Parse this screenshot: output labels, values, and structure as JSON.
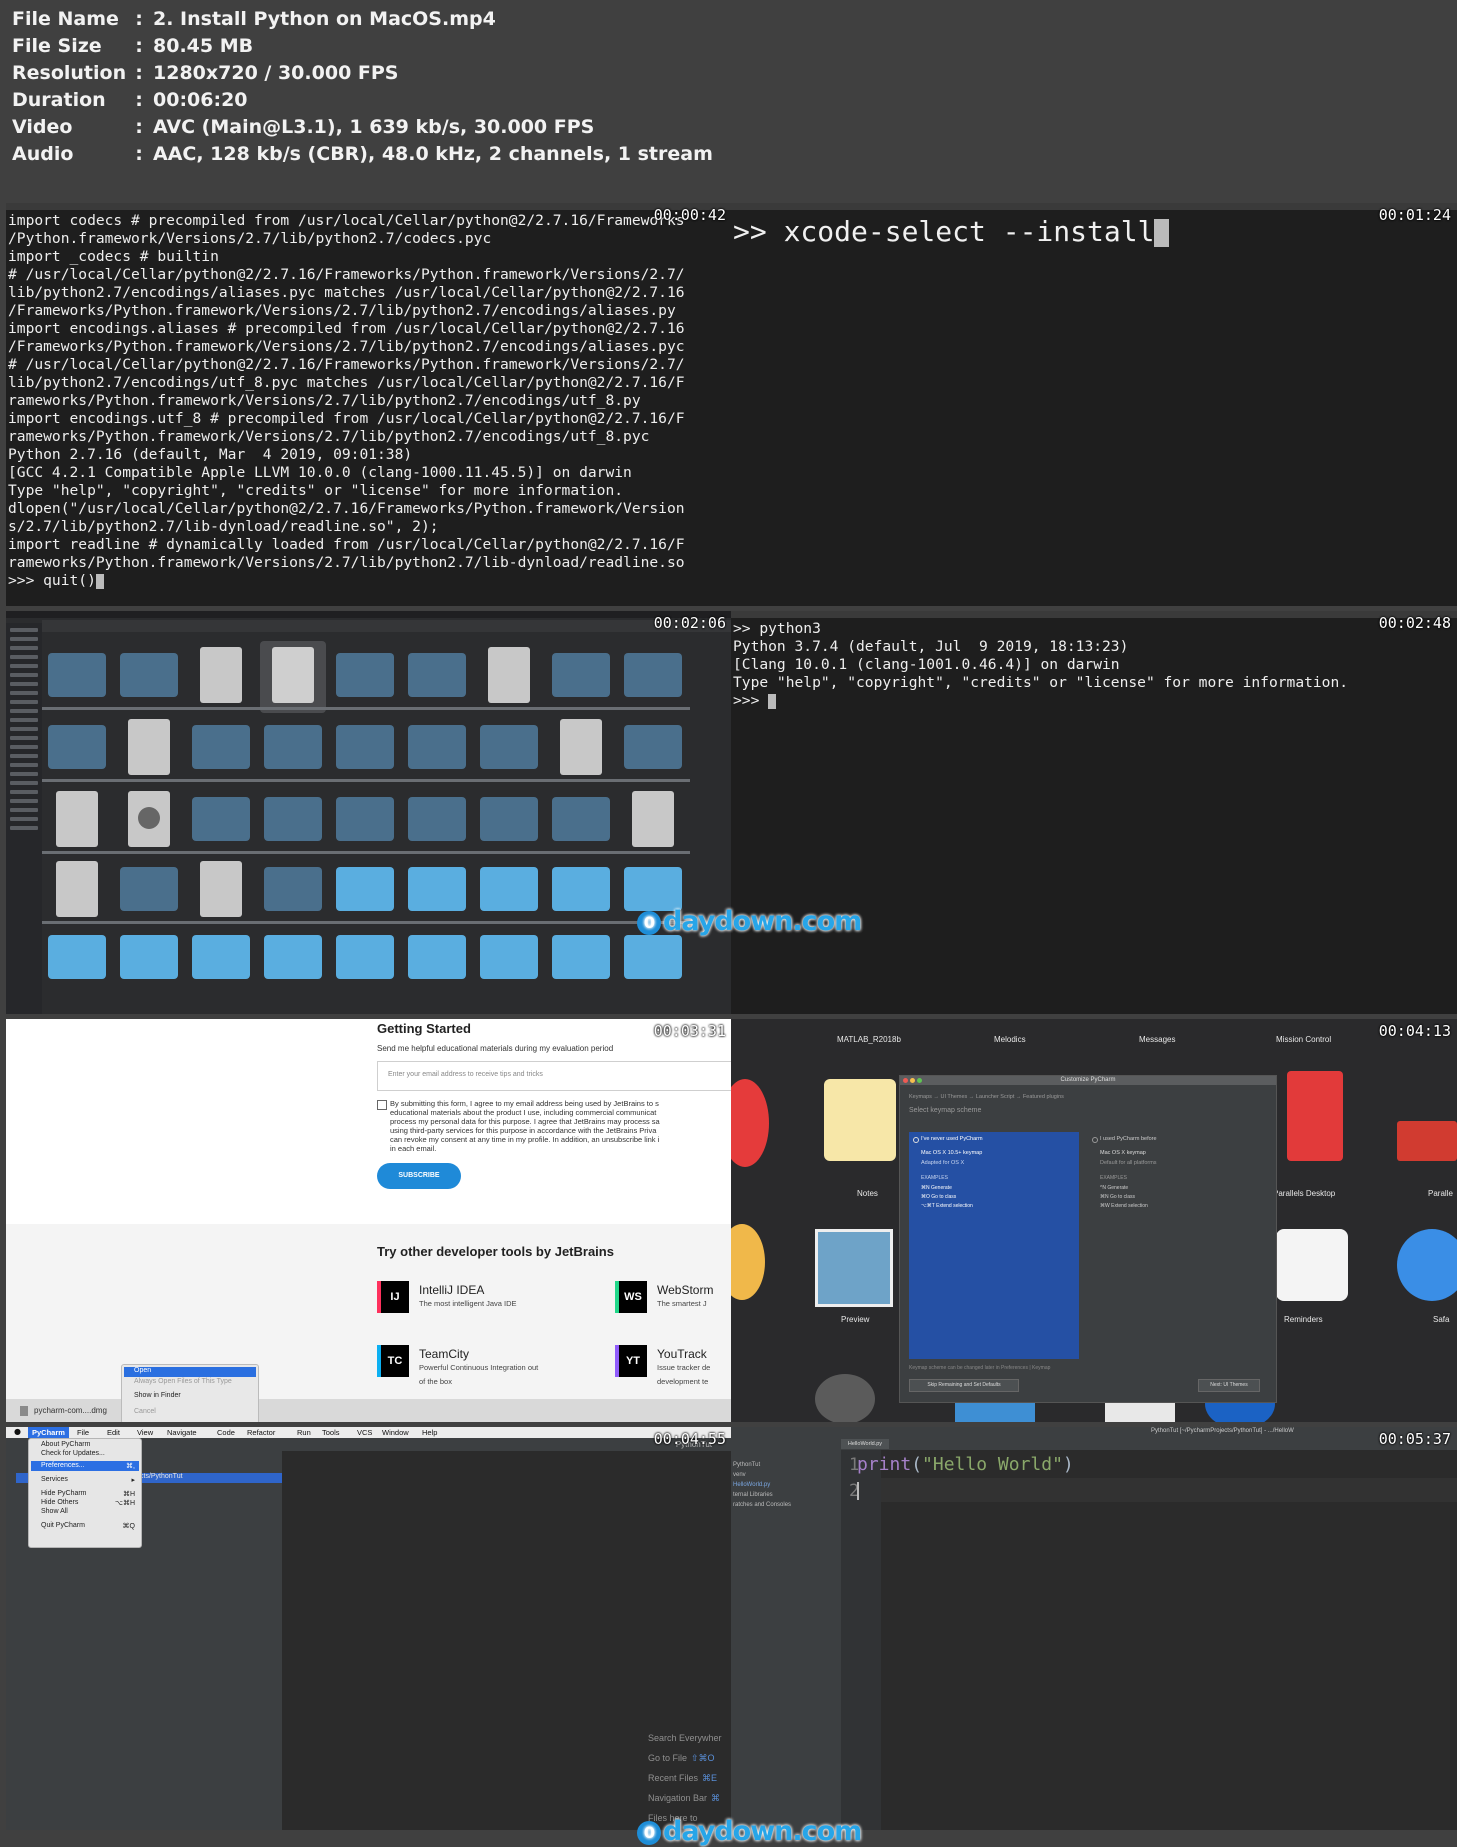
{
  "info": [
    {
      "key": "File Name",
      "sep": ":",
      "value": "2. Install Python on MacOS.mp4"
    },
    {
      "key": "File Size",
      "sep": ":",
      "value": "80.45 MB"
    },
    {
      "key": "Resolution",
      "sep": ":",
      "value": "1280x720 / 30.000 FPS"
    },
    {
      "key": "Duration",
      "sep": ":",
      "value": "00:06:20"
    },
    {
      "key": "Video",
      "sep": ":",
      "value": "AVC (Main@L3.1), 1 639 kb/s, 30.000 FPS"
    },
    {
      "key": "Audio",
      "sep": ":",
      "value": "AAC, 128 kb/s (CBR), 48.0 kHz, 2 channels, 1 stream"
    }
  ],
  "thumbs": [
    {
      "timestamp": "00:00:42",
      "lines": [
        "import codecs # precompiled from /usr/local/Cellar/python@2/2.7.16/Frameworks",
        "/Python.framework/Versions/2.7/lib/python2.7/codecs.pyc",
        "import _codecs # builtin",
        "# /usr/local/Cellar/python@2/2.7.16/Frameworks/Python.framework/Versions/2.7/",
        "lib/python2.7/encodings/aliases.pyc matches /usr/local/Cellar/python@2/2.7.16",
        "/Frameworks/Python.framework/Versions/2.7/lib/python2.7/encodings/aliases.py",
        "import encodings.aliases # precompiled from /usr/local/Cellar/python@2/2.7.16",
        "/Frameworks/Python.framework/Versions/2.7/lib/python2.7/encodings/aliases.pyc",
        "# /usr/local/Cellar/python@2/2.7.16/Frameworks/Python.framework/Versions/2.7/",
        "lib/python2.7/encodings/utf_8.pyc matches /usr/local/Cellar/python@2/2.7.16/F",
        "rameworks/Python.framework/Versions/2.7/lib/python2.7/encodings/utf_8.py",
        "import encodings.utf_8 # precompiled from /usr/local/Cellar/python@2/2.7.16/F",
        "rameworks/Python.framework/Versions/2.7/lib/python2.7/encodings/utf_8.pyc",
        "Python 2.7.16 (default, Mar  4 2019, 09:01:38)",
        "[GCC 4.2.1 Compatible Apple LLVM 10.0.0 (clang-1000.11.45.5)] on darwin",
        "Type \"help\", \"copyright\", \"credits\" or \"license\" for more information.",
        "dlopen(\"/usr/local/Cellar/python@2/2.7.16/Frameworks/Python.framework/Version",
        "s/2.7/lib/python2.7/lib-dynload/readline.so\", 2);",
        "import readline # dynamically loaded from /usr/local/Cellar/python@2/2.7.16/F",
        "rameworks/Python.framework/Versions/2.7/lib/python2.7/lib-dynload/readline.so",
        ">>> quit()"
      ]
    },
    {
      "timestamp": "00:01:24",
      "command": ">> xcode-select --install"
    },
    {
      "timestamp": "00:02:06"
    },
    {
      "timestamp": "00:02:48",
      "lines": [
        ">> python3",
        "Python 3.7.4 (default, Jul  9 2019, 18:13:23)",
        "[Clang 10.0.1 (clang-1001.0.46.4)] on darwin",
        "Type \"help\", \"copyright\", \"credits\" or \"license\" for more information.",
        ">>> "
      ]
    },
    {
      "timestamp": "00:03:31",
      "heading": "Getting Started",
      "sub": "Send me helpful educational materials during my evaluation period",
      "email_placeholder": "Enter your email address to receive tips and tricks",
      "consent": [
        "By submitting this form, I agree to my email address being used by JetBrains to s",
        "educational materials about the product I use, including commercial communicat",
        "process my personal data for this purpose. I agree that JetBrains may process sa",
        "using third-party services for this purpose in accordance with the JetBrains Priva",
        "can revoke my consent at any time in my profile. In addition, an unsubscribe link i",
        "in each email."
      ],
      "subscribe": "SUBSCRIBE",
      "try_heading": "Try other developer tools by JetBrains",
      "tools": [
        {
          "abbr": "IJ",
          "name": "IntelliJ IDEA",
          "desc": "The most intelligent Java IDE",
          "color": "#000000",
          "accent": "#fe315d"
        },
        {
          "abbr": "WS",
          "name": "WebStorm",
          "desc": "The smartest J",
          "color": "#000000",
          "accent": "#21d789"
        },
        {
          "abbr": "TC",
          "name": "TeamCity",
          "desc": "Powerful Continuous Integration out",
          "desc2": "of the box",
          "color": "#000000",
          "accent": "#0cb0f2"
        },
        {
          "abbr": "YT",
          "name": "YouTrack",
          "desc": "Issue tracker de",
          "desc2": "development te",
          "color": "#000000",
          "accent": "#905cfb"
        }
      ],
      "ctx_menu": [
        "Open",
        "Always Open Files of This Type",
        "Show in Finder",
        "Cancel"
      ],
      "download": "pycharm-com....dmg"
    },
    {
      "timestamp": "00:04:13",
      "top_apps": [
        "MATLAB_R2018b",
        "Melodics",
        "Messages",
        "Mission Control"
      ],
      "apps": [
        "Notes",
        "Parallels Desktop",
        "Paralle",
        "Preview",
        "Reminders",
        "Safa"
      ],
      "dialog_title": "Customize PyCharm",
      "dialog_crumbs": "Keymaps → UI Themes → Launcher Script → Featured plugins",
      "dialog_sub": "Select keymap scheme",
      "left_opt": "I've never used PyCharm",
      "left_keymap": "Mac OS X 10.5+ keymap",
      "left_adapted": "Adapted for OS X",
      "right_opt": "I used PyCharm before",
      "right_keymap": "Mac OS X keymap",
      "right_adapted": "Default for all platforms",
      "examples": "EXAMPLES",
      "left_ex": [
        "⌘N  Generate",
        "⌘O  Go to class",
        "⌥⌘T  Extend selection"
      ],
      "right_ex": [
        "^N  Generate",
        "⌘N  Go to class",
        "⌘W  Extend selection"
      ],
      "note": "Keymap scheme can be changed later in Preferences | Keymap",
      "skip_btn": "Skip Remaining and Set Defaults",
      "next_btn": "Next: UI Themes"
    },
    {
      "timestamp": "00:04:55",
      "menubar": [
        "PyCharm",
        "File",
        "Edit",
        "View",
        "Navigate",
        "Code",
        "Refactor",
        "Run",
        "Tools",
        "VCS",
        "Window",
        "Help"
      ],
      "menu": [
        {
          "label": "About PyCharm",
          "key": ""
        },
        {
          "label": "Check for Updates...",
          "key": ""
        },
        {
          "label": "Preferences...",
          "key": "⌘,"
        },
        {
          "label": "Services",
          "key": "▸"
        },
        {
          "label": "Hide PyCharm",
          "key": "⌘H"
        },
        {
          "label": "Hide Others",
          "key": "⌥⌘H"
        },
        {
          "label": "Show All",
          "key": ""
        },
        {
          "label": "Quit PyCharm",
          "key": "⌘Q"
        }
      ],
      "path": "cts/PythonTut",
      "title_right": "PythonTut",
      "hints": [
        {
          "label": "Search Everywher",
          "key": ""
        },
        {
          "label": "Go to File",
          "key": "⇧⌘O"
        },
        {
          "label": "Recent Files",
          "key": "⌘E"
        },
        {
          "label": "Navigation Bar",
          "key": "⌘"
        },
        {
          "label": "Files here to",
          "key": ""
        }
      ]
    },
    {
      "timestamp": "00:05:37",
      "title": "PythonTut [~/PycharmProjects/PythonTut] - .../HelloW",
      "tab": "HelloWorld.py",
      "tree": [
        "PythonTut",
        "venv",
        "HelloWorld.py",
        "ternal Libraries",
        "ratches and Consoles"
      ],
      "code_line1": "print(\"Hello World\")",
      "line_numbers": [
        "1",
        "2"
      ]
    }
  ],
  "watermark_text": "daydown.com",
  "watermark_o": "0"
}
